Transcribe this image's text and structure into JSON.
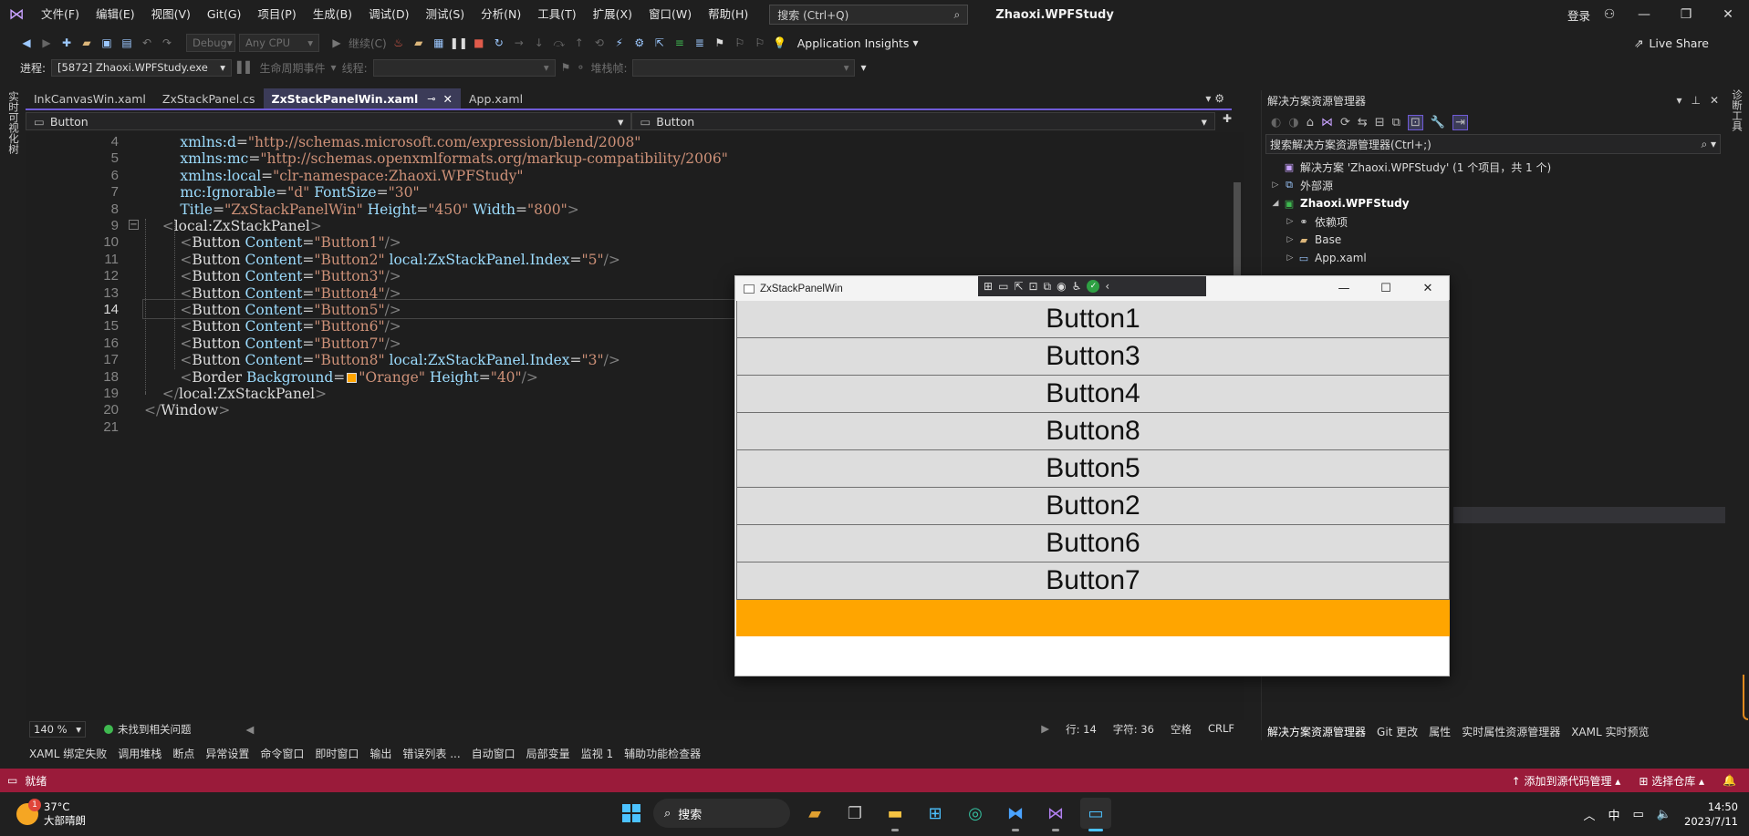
{
  "menu": [
    "文件(F)",
    "编辑(E)",
    "视图(V)",
    "Git(G)",
    "项目(P)",
    "生成(B)",
    "调试(D)",
    "测试(S)",
    "分析(N)",
    "工具(T)",
    "扩展(X)",
    "窗口(W)",
    "帮助(H)"
  ],
  "search": {
    "label": "搜索 (Ctrl+Q)",
    "icon": "search-icon"
  },
  "solution_title": "Zhaoxi.WPFStudy",
  "login": "登录",
  "toolbar": {
    "config": "Debug",
    "platform": "Any CPU",
    "continue": "继续(C)",
    "app_insights": "Application Insights",
    "live_share": "Live Share"
  },
  "debugbar": {
    "process_label": "进程:",
    "process_value": "[5872] Zhaoxi.WPFStudy.exe",
    "lifecycle": "生命周期事件",
    "thread_label": "线程:",
    "stack_label": "堆栈帧:"
  },
  "left_strip": "实时可视化树",
  "right_strip": "诊断工具",
  "tabs": [
    {
      "label": "InkCanvasWin.xaml",
      "active": false
    },
    {
      "label": "ZxStackPanel.cs",
      "active": false
    },
    {
      "label": "ZxStackPanelWin.xaml",
      "active": true
    },
    {
      "label": "App.xaml",
      "active": false
    }
  ],
  "nav": {
    "left": "Button",
    "right": "Button"
  },
  "code": [
    {
      "n": "4",
      "indent": "        ",
      "parts": [
        [
          "attr",
          "xmlns:d"
        ],
        [
          "tag",
          "="
        ],
        [
          "str",
          "\"http://schemas.microsoft.com/expression/blend/2008\""
        ]
      ]
    },
    {
      "n": "5",
      "indent": "        ",
      "parts": [
        [
          "attr",
          "xmlns:mc"
        ],
        [
          "tag",
          "="
        ],
        [
          "str",
          "\"http://schemas.openxmlformats.org/markup-compatibility/2006\""
        ]
      ]
    },
    {
      "n": "6",
      "indent": "        ",
      "parts": [
        [
          "attr",
          "xmlns:local"
        ],
        [
          "tag",
          "="
        ],
        [
          "str",
          "\"clr-namespace:Zhaoxi.WPFStudy\""
        ]
      ]
    },
    {
      "n": "7",
      "indent": "        ",
      "parts": [
        [
          "attr",
          "mc:Ignorable"
        ],
        [
          "tag",
          "="
        ],
        [
          "str",
          "\"d\""
        ],
        [
          "tag",
          " "
        ],
        [
          "attr",
          "FontSize"
        ],
        [
          "tag",
          "="
        ],
        [
          "str",
          "\"30\""
        ]
      ]
    },
    {
      "n": "8",
      "indent": "        ",
      "parts": [
        [
          "attr",
          "Title"
        ],
        [
          "tag",
          "="
        ],
        [
          "str",
          "\"ZxStackPanelWin\""
        ],
        [
          "tag",
          " "
        ],
        [
          "attr",
          "Height"
        ],
        [
          "tag",
          "="
        ],
        [
          "str",
          "\"450\""
        ],
        [
          "tag",
          " "
        ],
        [
          "attr",
          "Width"
        ],
        [
          "tag",
          "="
        ],
        [
          "str",
          "\"800\""
        ],
        [
          "bracket",
          ">"
        ]
      ]
    },
    {
      "n": "9",
      "indent": "    ",
      "parts": [
        [
          "bracket",
          "<"
        ],
        [
          "name",
          "local:ZxStackPanel"
        ],
        [
          "bracket",
          ">"
        ]
      ]
    },
    {
      "n": "10",
      "indent": "        ",
      "parts": [
        [
          "bracket",
          "<"
        ],
        [
          "name",
          "Button"
        ],
        [
          "tag",
          " "
        ],
        [
          "attr",
          "Content"
        ],
        [
          "tag",
          "="
        ],
        [
          "str",
          "\"Button1\""
        ],
        [
          "bracket",
          "/>"
        ]
      ]
    },
    {
      "n": "11",
      "indent": "        ",
      "parts": [
        [
          "bracket",
          "<"
        ],
        [
          "name",
          "Button"
        ],
        [
          "tag",
          " "
        ],
        [
          "attr",
          "Content"
        ],
        [
          "tag",
          "="
        ],
        [
          "str",
          "\"Button2\""
        ],
        [
          "tag",
          " "
        ],
        [
          "attr",
          "local:ZxStackPanel.Index"
        ],
        [
          "tag",
          "="
        ],
        [
          "str",
          "\"5\""
        ],
        [
          "bracket",
          "/>"
        ]
      ]
    },
    {
      "n": "12",
      "indent": "        ",
      "parts": [
        [
          "bracket",
          "<"
        ],
        [
          "name",
          "Button"
        ],
        [
          "tag",
          " "
        ],
        [
          "attr",
          "Content"
        ],
        [
          "tag",
          "="
        ],
        [
          "str",
          "\"Button3\""
        ],
        [
          "bracket",
          "/>"
        ]
      ]
    },
    {
      "n": "13",
      "indent": "        ",
      "parts": [
        [
          "bracket",
          "<"
        ],
        [
          "name",
          "Button"
        ],
        [
          "tag",
          " "
        ],
        [
          "attr",
          "Content"
        ],
        [
          "tag",
          "="
        ],
        [
          "str",
          "\"Button4\""
        ],
        [
          "bracket",
          "/>"
        ]
      ]
    },
    {
      "n": "14",
      "indent": "        ",
      "parts": [
        [
          "bracket",
          "<"
        ],
        [
          "name",
          "Button"
        ],
        [
          "tag",
          " "
        ],
        [
          "attr",
          "Content"
        ],
        [
          "tag",
          "="
        ],
        [
          "str",
          "\"Button5\""
        ],
        [
          "bracket",
          "/>"
        ]
      ]
    },
    {
      "n": "15",
      "indent": "        ",
      "parts": [
        [
          "bracket",
          "<"
        ],
        [
          "name",
          "Button"
        ],
        [
          "tag",
          " "
        ],
        [
          "attr",
          "Content"
        ],
        [
          "tag",
          "="
        ],
        [
          "str",
          "\"Button6\""
        ],
        [
          "bracket",
          "/>"
        ]
      ]
    },
    {
      "n": "16",
      "indent": "        ",
      "parts": [
        [
          "bracket",
          "<"
        ],
        [
          "name",
          "Button"
        ],
        [
          "tag",
          " "
        ],
        [
          "attr",
          "Content"
        ],
        [
          "tag",
          "="
        ],
        [
          "str",
          "\"Button7\""
        ],
        [
          "bracket",
          "/>"
        ]
      ]
    },
    {
      "n": "17",
      "indent": "        ",
      "parts": [
        [
          "bracket",
          "<"
        ],
        [
          "name",
          "Button"
        ],
        [
          "tag",
          " "
        ],
        [
          "attr",
          "Content"
        ],
        [
          "tag",
          "="
        ],
        [
          "str",
          "\"Button8\""
        ],
        [
          "tag",
          " "
        ],
        [
          "attr",
          "local:ZxStackPanel.Index"
        ],
        [
          "tag",
          "="
        ],
        [
          "str",
          "\"3\""
        ],
        [
          "bracket",
          "/>"
        ]
      ]
    },
    {
      "n": "18",
      "indent": "        ",
      "parts": [
        [
          "bracket",
          "<"
        ],
        [
          "name",
          "Border"
        ],
        [
          "tag",
          " "
        ],
        [
          "attr",
          "Background"
        ],
        [
          "tag",
          "="
        ],
        [
          "swatch",
          ""
        ],
        [
          "str",
          "\"Orange\""
        ],
        [
          "tag",
          " "
        ],
        [
          "attr",
          "Height"
        ],
        [
          "tag",
          "="
        ],
        [
          "str",
          "\"40\""
        ],
        [
          "bracket",
          "/>"
        ]
      ]
    },
    {
      "n": "19",
      "indent": "    ",
      "parts": [
        [
          "bracket",
          "</"
        ],
        [
          "name",
          "local:ZxStackPanel"
        ],
        [
          "bracket",
          ">"
        ]
      ]
    },
    {
      "n": "20",
      "indent": "",
      "parts": [
        [
          "bracket",
          "</"
        ],
        [
          "name",
          "Window"
        ],
        [
          "bracket",
          ">"
        ]
      ]
    },
    {
      "n": "21",
      "indent": "",
      "parts": []
    }
  ],
  "current_line": "14",
  "status": {
    "zoom": "140 %",
    "issues": "未找到相关问题",
    "line": "行: 14",
    "char": "字符: 36",
    "space": "空格",
    "eol": "CRLF"
  },
  "tool_tabs": [
    "XAML 绑定失败",
    "调用堆栈",
    "断点",
    "异常设置",
    "命令窗口",
    "即时窗口",
    "输出",
    "错误列表 ...",
    "自动窗口",
    "局部变量",
    "监视 1",
    "辅助功能检查器"
  ],
  "solution_explorer": {
    "title": "解决方案资源管理器",
    "search_placeholder": "搜索解决方案资源管理器(Ctrl+;)",
    "tree": [
      {
        "label": "解决方案 'Zhaoxi.WPFStudy' (1 个项目，共 1 个)",
        "depth": 0,
        "arrow": "",
        "icon": "solution-icon",
        "bold": false
      },
      {
        "label": "外部源",
        "depth": 0,
        "arrow": "▷",
        "icon": "external-source-icon",
        "bold": false
      },
      {
        "label": "Zhaoxi.WPFStudy",
        "depth": 0,
        "arrow": "◢",
        "icon": "csharp-project-icon",
        "bold": true
      },
      {
        "label": "依赖项",
        "depth": 1,
        "arrow": "▷",
        "icon": "dependencies-icon",
        "bold": false
      },
      {
        "label": "Base",
        "depth": 1,
        "arrow": "▷",
        "icon": "folder-icon",
        "bold": false
      },
      {
        "label": "App.xaml",
        "depth": 1,
        "arrow": "▷",
        "icon": "xaml-file-icon",
        "bold": false
      }
    ],
    "bottom_tabs": [
      "解决方案资源管理器",
      "Git 更改",
      "属性",
      "实时属性资源管理器",
      "XAML 实时预览"
    ]
  },
  "wpf_window": {
    "title": "ZxStackPanelWin",
    "buttons": [
      "Button1",
      "Button3",
      "Button4",
      "Button8",
      "Button5",
      "Button2",
      "Button6",
      "Button7"
    ],
    "border_color": "#FFA500"
  },
  "statusbar": {
    "ready": "就绪",
    "add_source": "添加到源代码管理",
    "select_repo": "选择仓库",
    "color": "#9A1B3A"
  },
  "taskbar": {
    "weather_temp": "37°C",
    "weather_desc": "大部晴朗",
    "weather_badge": "1",
    "search": "搜索",
    "ime": "中",
    "time": "14:50",
    "date": "2023/7/11"
  },
  "colors": {
    "accent": "#6F5BD6",
    "string": "#CE9178",
    "attribute": "#9CDCFE"
  }
}
